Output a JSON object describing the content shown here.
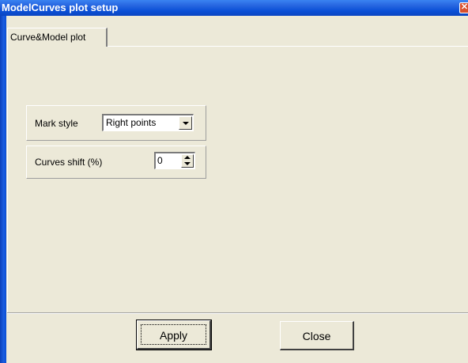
{
  "window": {
    "title": "ModelCurves plot setup",
    "close_glyph": "✕"
  },
  "tabs": [
    {
      "label": "Curve&Model plot",
      "active": true
    }
  ],
  "mark_style": {
    "label": "Mark style",
    "selected": "Right points"
  },
  "curves_shift": {
    "label": "Curves shift (%)",
    "value": "0"
  },
  "buttons": {
    "apply": "Apply",
    "close": "Close"
  },
  "icons": {
    "combo_arrow": "chevron-down-icon",
    "spin_up": "triangle-up-icon",
    "spin_down": "triangle-down-icon"
  },
  "colors": {
    "face": "#ece9d8",
    "titlebar": "#0a4fd6",
    "close_button": "#d9502e"
  }
}
